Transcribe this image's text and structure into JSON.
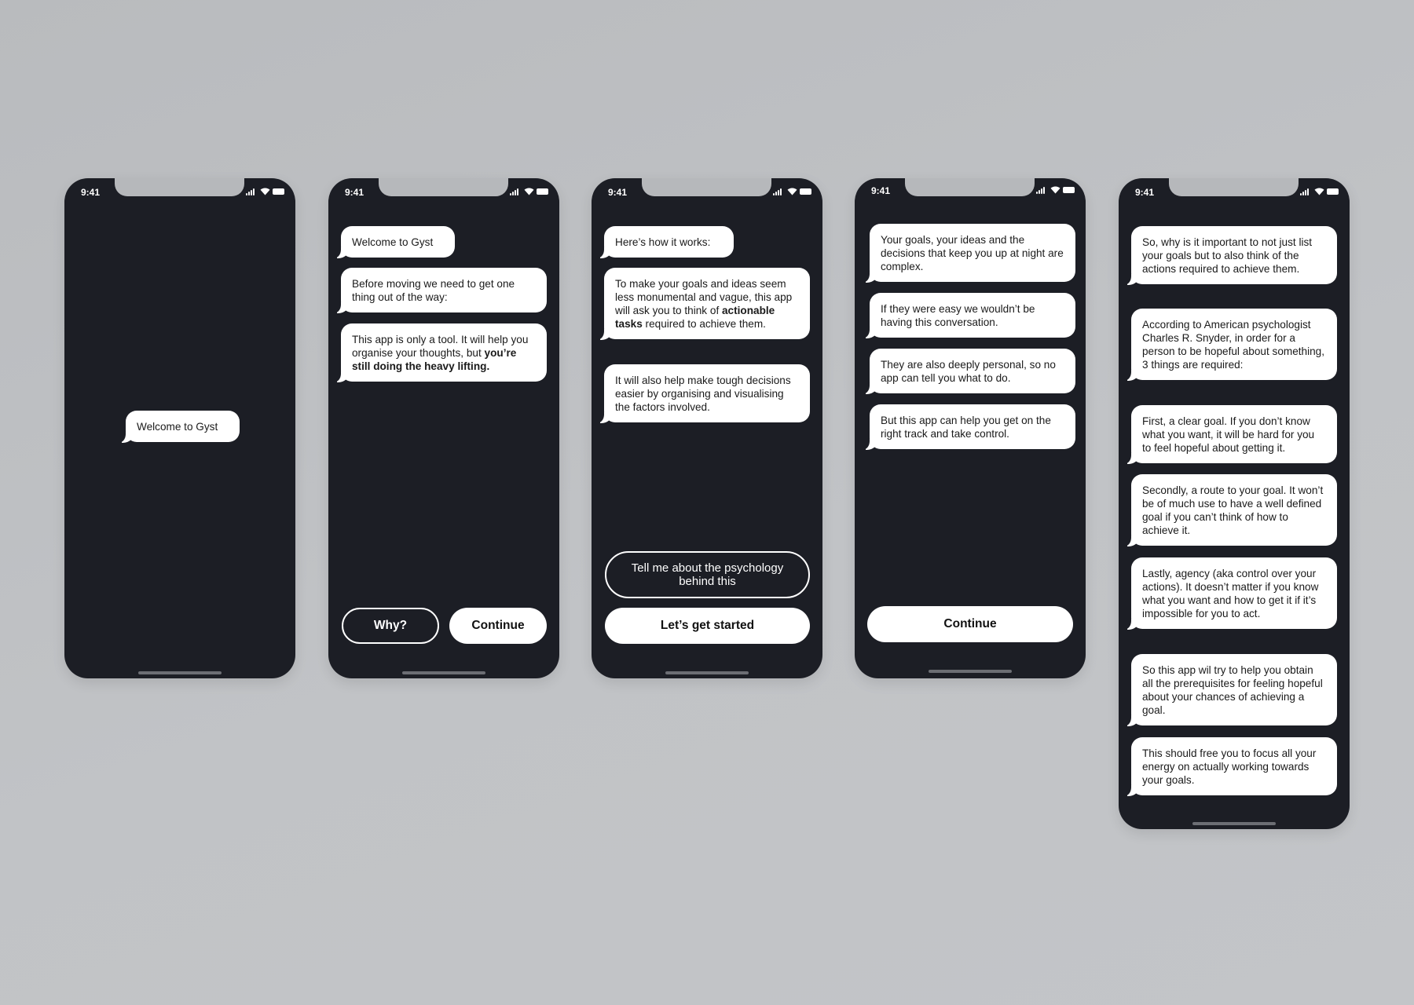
{
  "status": {
    "time": "9:41"
  },
  "screens": [
    {
      "id": "splash",
      "bubbles": [
        {
          "text": "Welcome to Gyst"
        }
      ]
    },
    {
      "id": "intro",
      "bubbles": [
        {
          "text": "Welcome to Gyst"
        },
        {
          "text": "Before moving we need to get one thing out of the way:"
        },
        {
          "text_before": "This app is only a tool. It will help you organise your thoughts, but ",
          "text_bold": "you’re still doing the heavy lifting."
        }
      ],
      "buttons": {
        "secondary": "Why?",
        "primary": "Continue"
      }
    },
    {
      "id": "how-it-works",
      "bubbles": [
        {
          "text": "Here’s how it works:"
        },
        {
          "text_before": "To make your goals and ideas seem less monumental and vague, this app will ask you to think of ",
          "text_bold": "actionable tasks",
          "text_after": " required to achieve them."
        },
        {
          "text": "It will also help make tough decisions easier by organising and visualising the factors involved."
        }
      ],
      "buttons": {
        "secondary": "Tell me about the psychology behind this",
        "primary": "Let’s get started"
      }
    },
    {
      "id": "why",
      "bubbles": [
        {
          "text": "Your goals, your ideas and the decisions that keep you up at night are complex."
        },
        {
          "text": "If they were easy we wouldn’t be having this conversation."
        },
        {
          "text": "They are also deeply personal, so no app can tell you what to do."
        },
        {
          "text": "But this app can help you get on the right track and take control."
        }
      ],
      "buttons": {
        "primary": "Continue"
      }
    },
    {
      "id": "psychology",
      "bubbles": [
        {
          "text": "So, why is it important to not just list your goals but to also think of the actions required to achieve them."
        },
        {
          "text": "According to American psychologist Charles R. Snyder, in order for a person to be hopeful about something, 3 things are required:"
        },
        {
          "text": "First, a clear goal. If you don’t know what you want, it will be hard for you to feel hopeful about getting it."
        },
        {
          "text": "Secondly, a route to your goal. It won’t be of much use to have a well defined goal if you can’t think of how to achieve it."
        },
        {
          "text": "Lastly, agency (aka control over your actions). It doesn’t matter if you know what you want and how to get it if it’s impossible for you to act."
        },
        {
          "text": "So this app wil try to help you obtain all the prerequisites for feeling hopeful about your chances of achieving a goal."
        },
        {
          "text": "This should free you to focus all your energy on actually working towards your goals."
        }
      ]
    }
  ],
  "icons": [
    "signal-icon",
    "wifi-icon",
    "battery-icon"
  ],
  "colors": {
    "background": "#bfc1c4",
    "phone": "#1c1e25",
    "bubble": "#ffffff",
    "text": "#1a1a1a"
  }
}
